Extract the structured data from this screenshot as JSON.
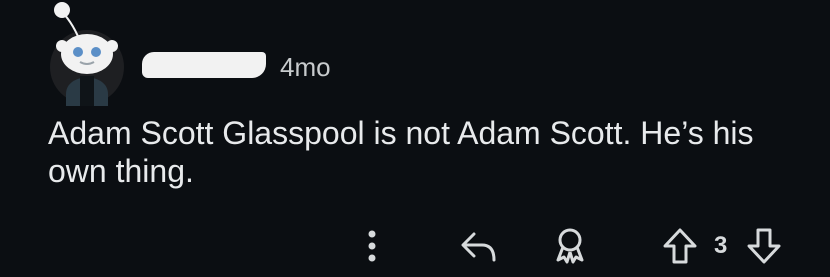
{
  "comment": {
    "timestamp": "4mo",
    "body": "Adam Scott Glasspool is not Adam Scott. He’s his own thing.",
    "vote_count": "3"
  },
  "icons": {
    "avatar": "snoo-avatar",
    "more": "vertical-ellipsis-icon",
    "reply": "reply-arrow-icon",
    "award": "award-icon",
    "upvote": "upvote-arrow-icon",
    "downvote": "downvote-arrow-icon"
  },
  "colors": {
    "background": "#0b0e12",
    "text": "#e8eaec",
    "muted": "#c8cbcd"
  }
}
